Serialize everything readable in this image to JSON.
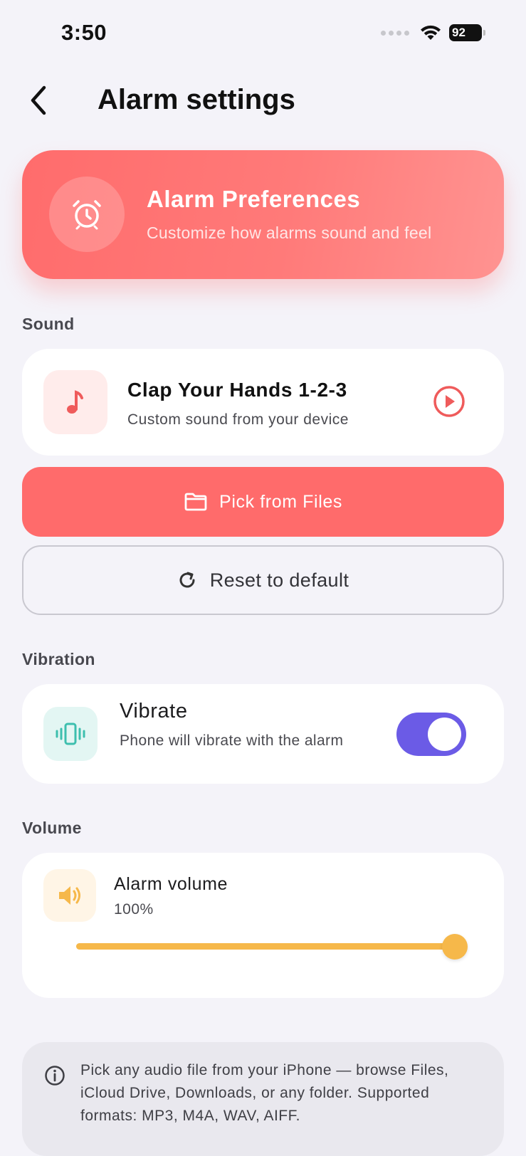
{
  "status_bar": {
    "time": "3:50",
    "battery": "92"
  },
  "nav": {
    "title": "Alarm settings"
  },
  "hero": {
    "title": "Alarm Preferences",
    "subtitle": "Customize how alarms sound and feel",
    "icon": "alarm-clock-icon"
  },
  "sound": {
    "section_label": "Sound",
    "track_title": "Clap Your Hands 1-2-3",
    "track_subtitle": "Custom sound from your device",
    "pick_label": "Pick from Files",
    "reset_label": "Reset to default"
  },
  "vibration": {
    "section_label": "Vibration",
    "title": "Vibrate",
    "subtitle": "Phone will vibrate with the alarm",
    "enabled": true
  },
  "volume": {
    "section_label": "Volume",
    "title": "Alarm volume",
    "value_label": "100%",
    "level": 1.0
  },
  "info": {
    "text": "Pick any audio file from your iPhone — browse Files, iCloud Drive, Downloads, or any folder. Supported formats: MP3, M4A, WAV, AIFF."
  },
  "colors": {
    "accent_red": "#ff6b6b",
    "toggle_purple": "#6b5be6",
    "volume_amber": "#f6b84a",
    "vibe_teal": "#3dbfae"
  }
}
